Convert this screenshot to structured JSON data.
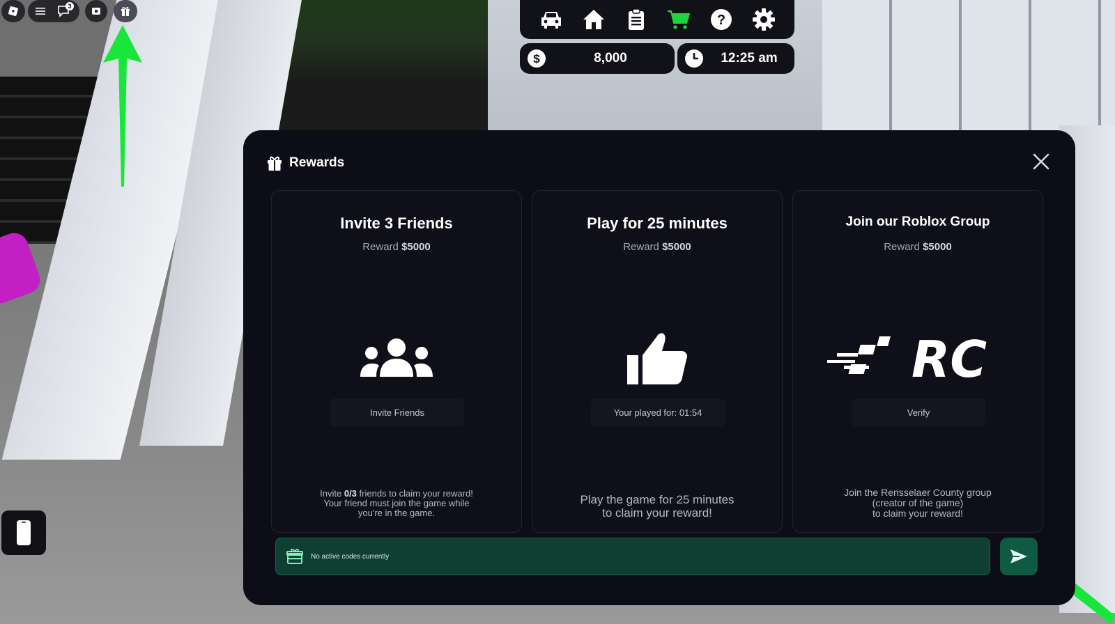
{
  "topbar": {
    "icons": [
      "roblox-logo-icon",
      "menu-icon",
      "chat-icon",
      "record-icon",
      "gift-icon"
    ],
    "chat_badge": "3"
  },
  "hud": {
    "icons": [
      "car-icon",
      "home-icon",
      "clipboard-icon",
      "shop-cart-icon",
      "help-icon",
      "gear-icon"
    ],
    "money": "8,000",
    "time": "12:25 am",
    "accent_color": "#1fd43a"
  },
  "modal": {
    "title": "Rewards",
    "cards": [
      {
        "title": "Invite 3 Friends",
        "reward_prefix": "Reward",
        "reward_amount": "$5000",
        "button_label": "Invite Friends",
        "desc_1": "Invite ",
        "desc_bold": "0/3",
        "desc_2": " friends to claim your reward!",
        "desc_3": "Your friend must join the game while",
        "desc_4": "you're in the game."
      },
      {
        "title": "Play for 25 minutes",
        "reward_prefix": "Reward",
        "reward_amount": "$5000",
        "button_label": "Your played for: 01:54",
        "desc_line_1": "Play the game for 25 minutes",
        "desc_line_2": "to claim your reward!"
      },
      {
        "title": "Join our Roblox Group",
        "reward_prefix": "Reward",
        "reward_amount": "$5000",
        "logo_text": "RC",
        "button_label": "Verify",
        "desc_line_1": "Join the Rensselaer County group",
        "desc_line_2": "(creator of the game)",
        "desc_line_3": "to claim your reward!"
      }
    ],
    "code_placeholder": "No active codes currently",
    "code_value": ""
  },
  "colors": {
    "modal_bg": "#0d0d17",
    "code_bar_bg": "#0f3f33",
    "send_btn_bg": "#0f5a43",
    "arrow_color": "#19e63b"
  }
}
